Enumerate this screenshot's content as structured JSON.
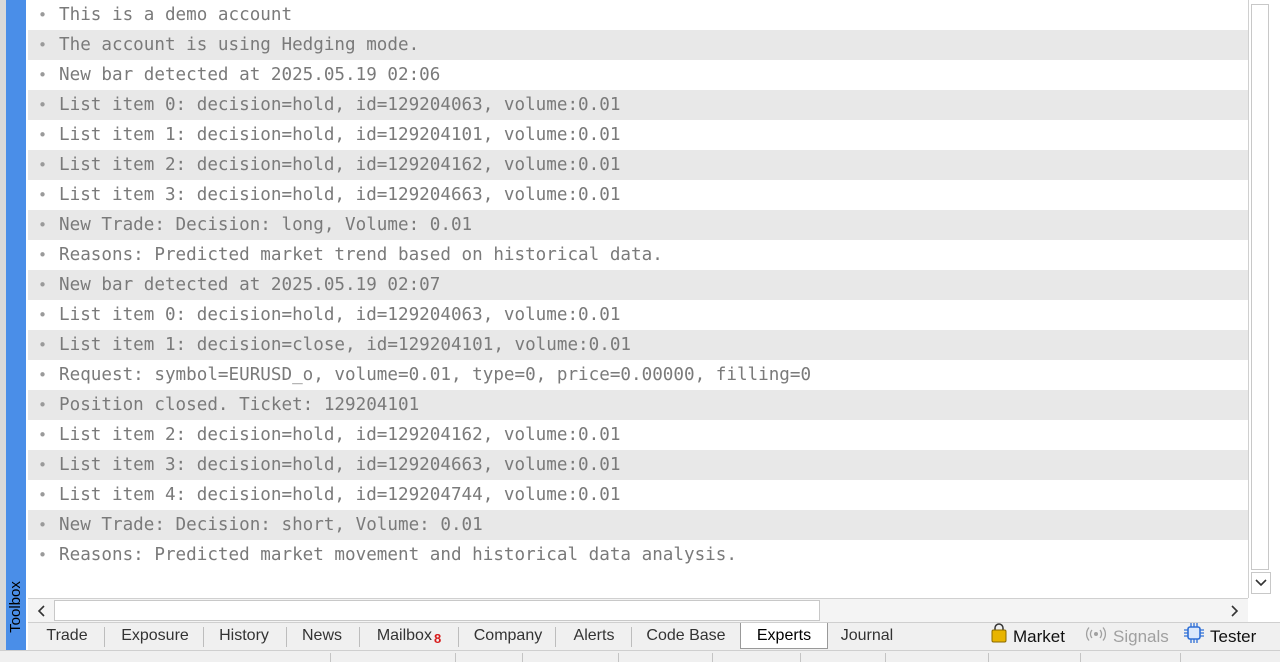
{
  "toolbox": {
    "label": "Toolbox"
  },
  "log_rows": [
    "This is a demo account",
    "The account is using Hedging mode.",
    "New bar detected at 2025.05.19 02:06",
    "List item 0: decision=hold, id=129204063, volume:0.01",
    "List item 1: decision=hold, id=129204101, volume:0.01",
    "List item 2: decision=hold, id=129204162, volume:0.01",
    "List item 3: decision=hold, id=129204663, volume:0.01",
    "New Trade: Decision: long, Volume: 0.01",
    "Reasons: Predicted market trend based on historical data.",
    "New bar detected at 2025.05.19 02:07",
    "List item 0: decision=hold, id=129204063, volume:0.01",
    "List item 1: decision=close, id=129204101, volume:0.01",
    "Request: symbol=EURUSD_o, volume=0.01, type=0, price=0.00000, filling=0",
    "Position closed. Ticket: 129204101",
    "List item 2: decision=hold, id=129204162, volume:0.01",
    "List item 3: decision=hold, id=129204663, volume:0.01",
    "List item 4: decision=hold, id=129204744, volume:0.01",
    "New Trade: Decision: short, Volume: 0.01",
    "Reasons: Predicted market movement and historical data analysis."
  ],
  "bullet": "•",
  "scroll": {
    "down_arrow": "⌄",
    "left_arrow": "‹",
    "right_arrow": "›"
  },
  "tabs": [
    {
      "label": "Trade"
    },
    {
      "label": "Exposure"
    },
    {
      "label": "History"
    },
    {
      "label": "News"
    },
    {
      "label": "Mailbox",
      "badge": "8"
    },
    {
      "label": "Company"
    },
    {
      "label": "Alerts"
    },
    {
      "label": "Code Base"
    },
    {
      "label": "Experts",
      "active": true
    },
    {
      "label": "Journal"
    }
  ],
  "right_tools": {
    "market": {
      "label": "Market",
      "icon": "shopping-bag-icon"
    },
    "signals": {
      "label": "Signals",
      "icon": "broadcast-icon"
    },
    "tester": {
      "label": "Tester",
      "icon": "cpu-chip-icon"
    }
  },
  "colors": {
    "accent": "#4a8ee8",
    "badge": "#d81b1b",
    "row_alt": "#e8e8e8",
    "market_icon": "#e8b400",
    "tester_icon": "#2f6fd6"
  }
}
